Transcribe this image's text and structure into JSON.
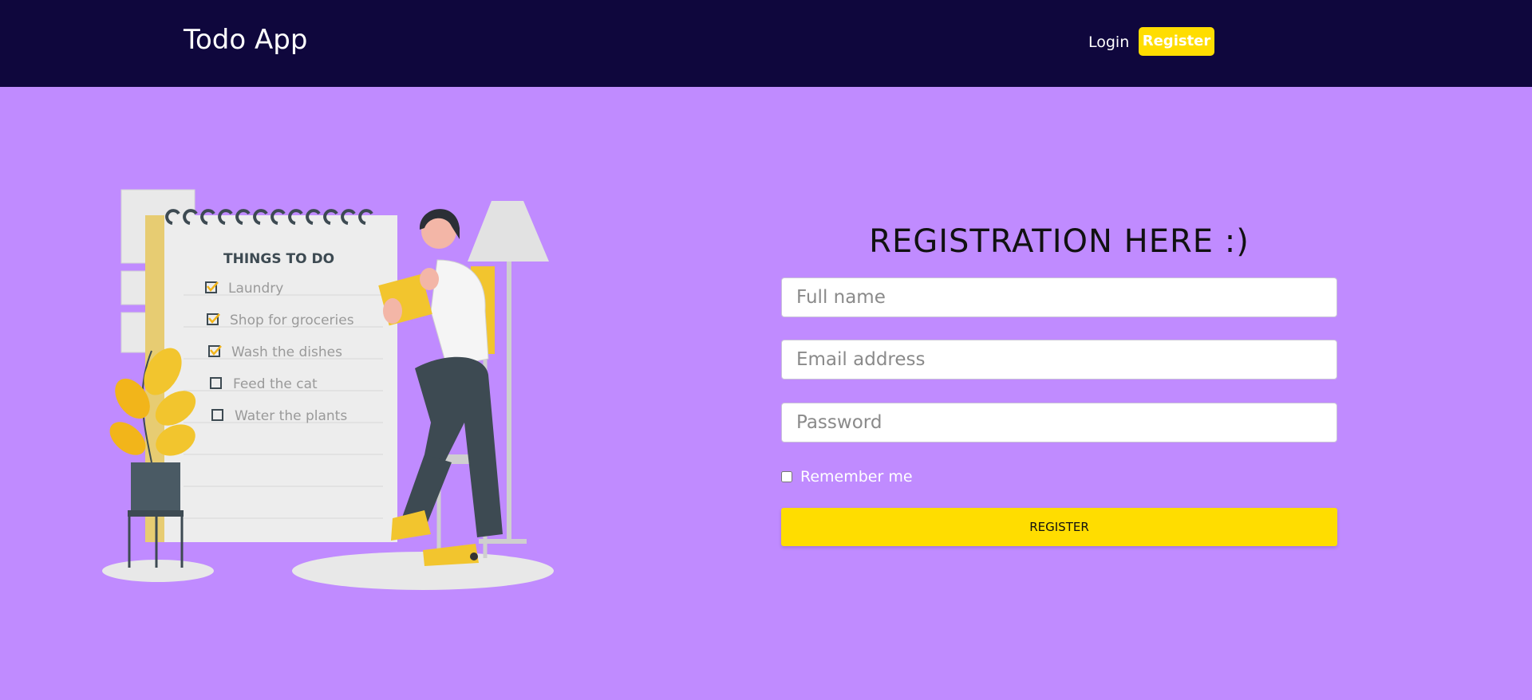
{
  "navbar": {
    "brand": "Todo App",
    "login_label": "Login",
    "register_label": "Register"
  },
  "illustration": {
    "notepad_title": "THINGS TO DO",
    "items": [
      {
        "label": "Laundry",
        "checked": true
      },
      {
        "label": "Shop for groceries",
        "checked": true
      },
      {
        "label": "Wash the dishes",
        "checked": true
      },
      {
        "label": "Feed the cat",
        "checked": false
      },
      {
        "label": "Water the plants",
        "checked": false
      }
    ]
  },
  "form": {
    "title": "REGISTRATION HERE :)",
    "full_name_placeholder": "Full name",
    "email_placeholder": "Email address",
    "password_placeholder": "Password",
    "remember_label": "Remember me",
    "submit_label": "REGISTER"
  },
  "colors": {
    "navbar": "#0f073d",
    "background": "#c08bff",
    "accent": "#ffdd00"
  }
}
